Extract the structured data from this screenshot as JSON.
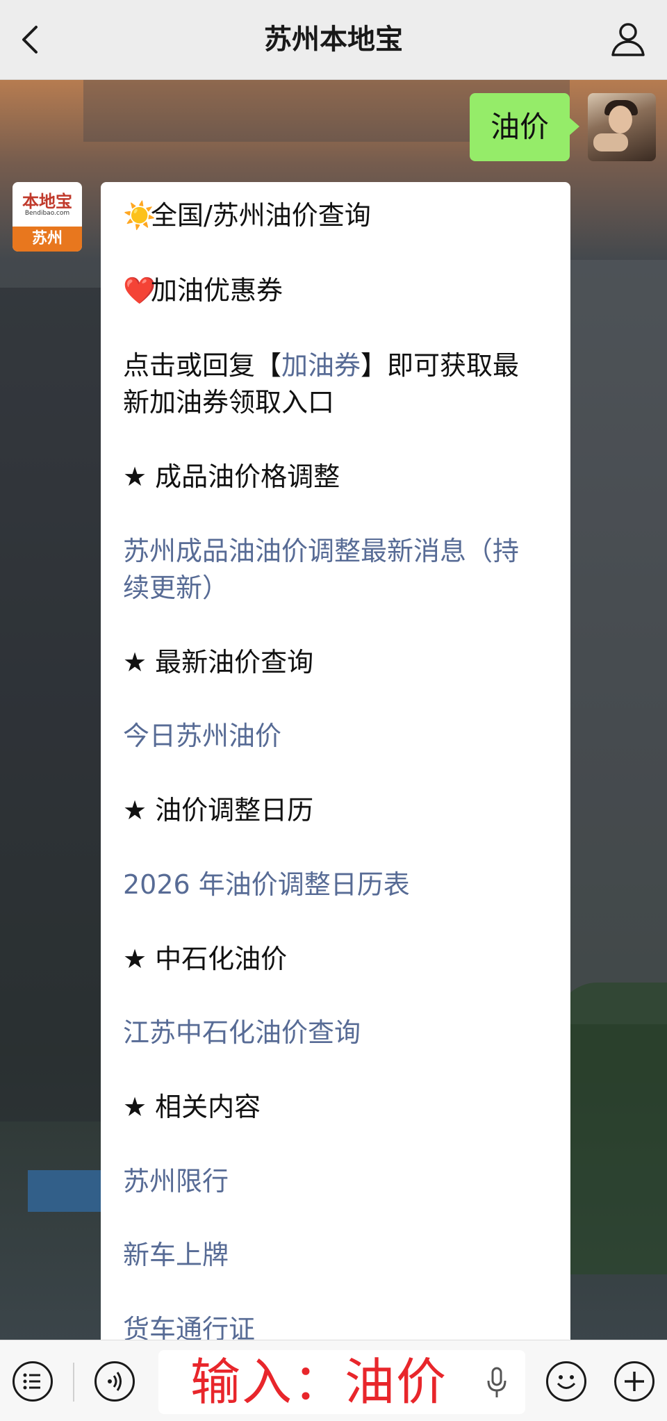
{
  "nav": {
    "title": "苏州本地宝",
    "back_icon": "chevron-left-icon",
    "profile_icon": "user-icon"
  },
  "user_message": {
    "text": "油价"
  },
  "bot_avatar": {
    "brand": "本地宝",
    "url": "Bendibao.com",
    "city": "苏州"
  },
  "bot_message": {
    "line1_emoji": "☀️",
    "line1_text": "全国/苏州油价查询",
    "line2_emoji": "❤️",
    "line2_text": "加油优惠券",
    "line3_pre": "点击或回复【",
    "line3_link": "加油券",
    "line3_post": "】即可获取最",
    "line3_wrap": "新加油券领取入口",
    "h1": "★ 成品油价格调整",
    "l1a": "苏州成品油油价调整最新消息（持",
    "l1b": "续更新）",
    "h2": "★ 最新油价查询",
    "l2": "今日苏州油价",
    "h3": "★ 油价调整日历",
    "l3": "2026 年油价调整日历表",
    "h4": "★ 中石化油价",
    "l4": "江苏中石化油价查询",
    "h5": "★ 相关内容",
    "l5": "苏州限行",
    "l6": "新车上牌",
    "l7": "货车通行证"
  },
  "input_bar": {
    "overlay_text": "输入：油价",
    "menu_icon": "list-menu-icon",
    "voice_icon": "voice-toggle-icon",
    "mic_icon": "microphone-icon",
    "emoji_icon": "emoji-icon",
    "plus_icon": "plus-icon"
  },
  "colors": {
    "link": "#576b95",
    "user_bubble": "#95ec69",
    "overlay_text": "#e8262b"
  }
}
